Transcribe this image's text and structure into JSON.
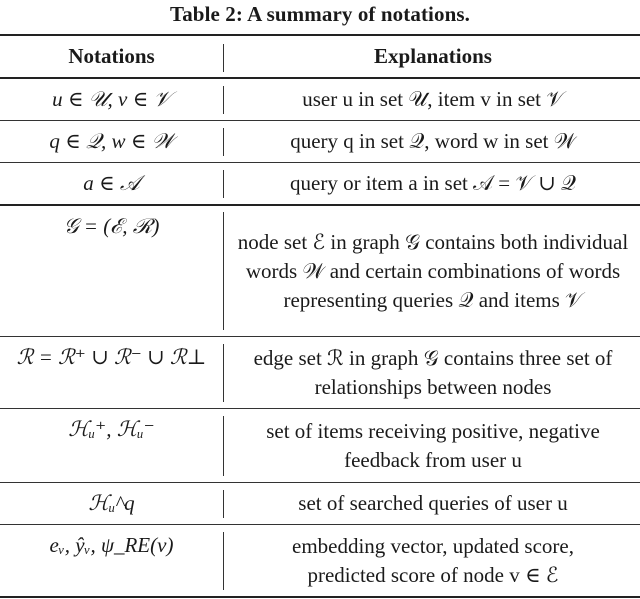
{
  "caption": "Table 2: A summary of notations.",
  "table": {
    "headers": [
      "Notations",
      "Explanations"
    ],
    "rows": [
      {
        "notation": "u ∈ 𝒰, v ∈ 𝒱",
        "explanation": "user u in set 𝒰, item v in set 𝒱"
      },
      {
        "notation": "q ∈ 𝒬, w ∈ 𝒲",
        "explanation": "query q in set 𝒬, word w in set 𝒲"
      },
      {
        "notation": "a ∈ 𝒜",
        "explanation": "query or item a in set 𝒜 = 𝒱 ∪ 𝒬"
      },
      {
        "notation": "𝒢 = (ℰ, ℛ)",
        "explanation": "node set ℰ in graph 𝒢 contains both individual words 𝒲 and certain combinations of words representing queries 𝒬 and items 𝒱"
      },
      {
        "notation": "ℛ = ℛ⁺ ∪ ℛ⁻ ∪ ℛ⊥",
        "explanation": "edge set ℛ in graph 𝒢 contains three set of relationships between nodes"
      },
      {
        "notation": "ℋᵤ⁺, ℋᵤ⁻",
        "explanation": "set of items receiving positive, negative feedback from user u"
      },
      {
        "notation": "ℋᵤ^q",
        "explanation": "set of searched queries of user u"
      },
      {
        "notation": "eᵥ, ŷᵥ, ψ_RE(v)",
        "explanation": "embedding vector, updated score, predicted score of node v ∈ ℰ"
      }
    ]
  }
}
